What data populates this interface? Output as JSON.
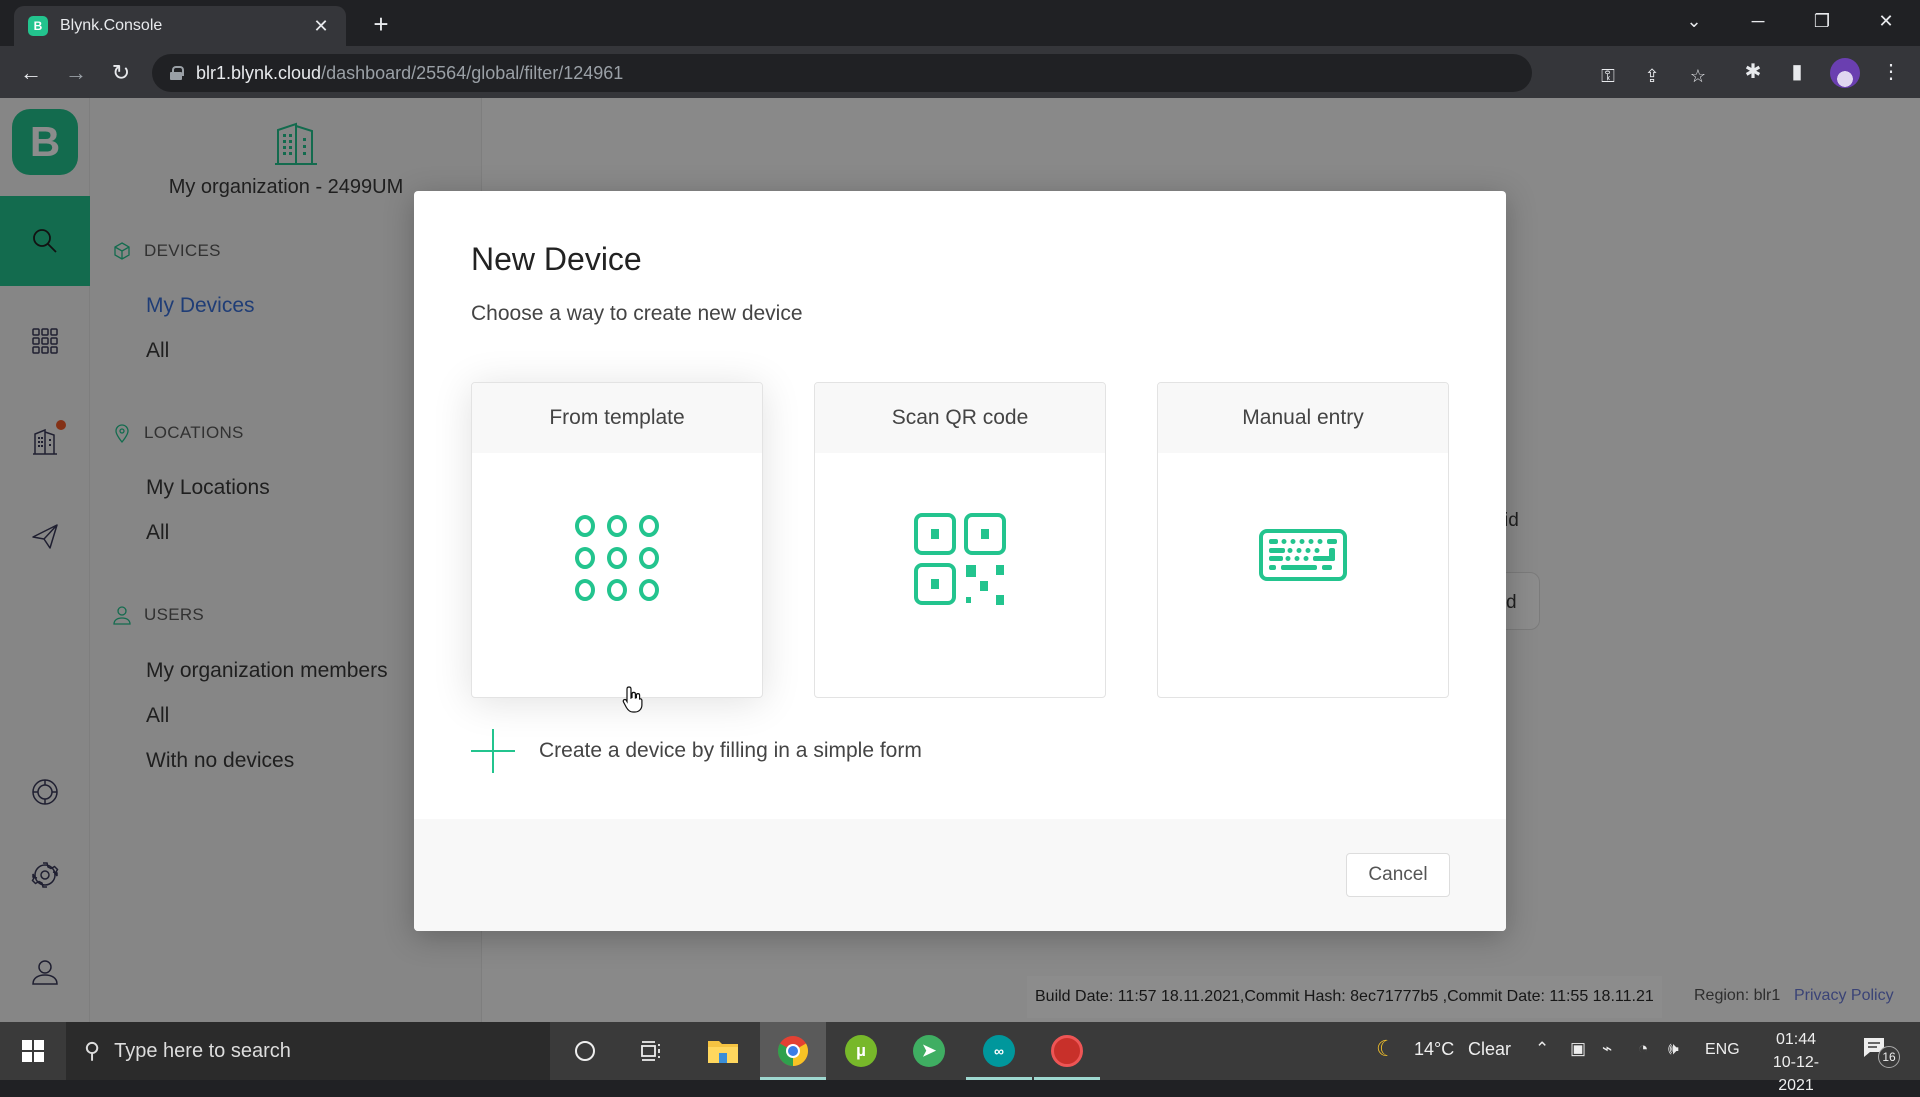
{
  "browser": {
    "tab_title": "Blynk.Console",
    "tab_favicon_letter": "B",
    "url_host": "blr1.blynk.cloud",
    "url_path": "/dashboard/25564/global/filter/124961",
    "icons": {
      "back": "←",
      "forward": "→",
      "reload": "↻",
      "key": "⚿",
      "share": "⇪",
      "star": "☆",
      "extensions": "✱",
      "sidepanel": "▮",
      "menu": "⋮",
      "tab_search": "⌄",
      "minimize": "─",
      "restore": "❐",
      "close": "✕",
      "tab_close": "✕",
      "new_tab": "+"
    }
  },
  "rail": {
    "logo_letter": "B",
    "items": [
      {
        "name": "search",
        "active": true
      },
      {
        "name": "templates",
        "active": false
      },
      {
        "name": "organizations",
        "active": false,
        "has_notification": true
      },
      {
        "name": "send",
        "active": false
      },
      {
        "name": "help",
        "active": false
      },
      {
        "name": "settings",
        "active": false
      },
      {
        "name": "profile",
        "active": false
      }
    ]
  },
  "sidenav": {
    "org_name": "My organization - 2499UM",
    "sections": [
      {
        "title": "DEVICES",
        "links": [
          {
            "label": "My Devices",
            "active": true
          },
          {
            "label": "All",
            "active": false
          }
        ]
      },
      {
        "title": "LOCATIONS",
        "links": [
          {
            "label": "My Locations",
            "active": false
          },
          {
            "label": "All",
            "active": false
          }
        ]
      },
      {
        "title": "USERS",
        "links": [
          {
            "label": "My organization members",
            "active": false
          },
          {
            "label": "All",
            "active": false
          },
          {
            "label": "With no devices",
            "active": false
          }
        ]
      }
    ]
  },
  "background": {
    "partial_text_1": "id",
    "partial_button_text": "d"
  },
  "modal": {
    "title": "New Device",
    "subtitle": "Choose a way to create new device",
    "options": [
      {
        "label": "From template",
        "icon": "template-grid-icon"
      },
      {
        "label": "Scan QR code",
        "icon": "qr-code-icon"
      },
      {
        "label": "Manual entry",
        "icon": "keyboard-icon"
      }
    ],
    "simple_form_label": "Create a device by filling in a simple form",
    "cancel_label": "Cancel",
    "accent_color": "#23c48e"
  },
  "footer": {
    "build_info": "Build Date: 11:57 18.11.2021,Commit Hash: 8ec71777b5 ,Commit Date: 11:55 18.11.21",
    "region": "Region: blr1",
    "privacy_label": "Privacy Policy"
  },
  "taskbar": {
    "search_placeholder": "Type here to search",
    "apps": [
      "cortana",
      "task-view",
      "file-explorer",
      "chrome",
      "utorrent",
      "telegram",
      "arduino",
      "screen-recorder"
    ],
    "weather_temp": "14°C",
    "weather_desc": "Clear",
    "language": "ENG",
    "time": "01:44",
    "date": "10-12-2021",
    "notification_count": "16"
  }
}
